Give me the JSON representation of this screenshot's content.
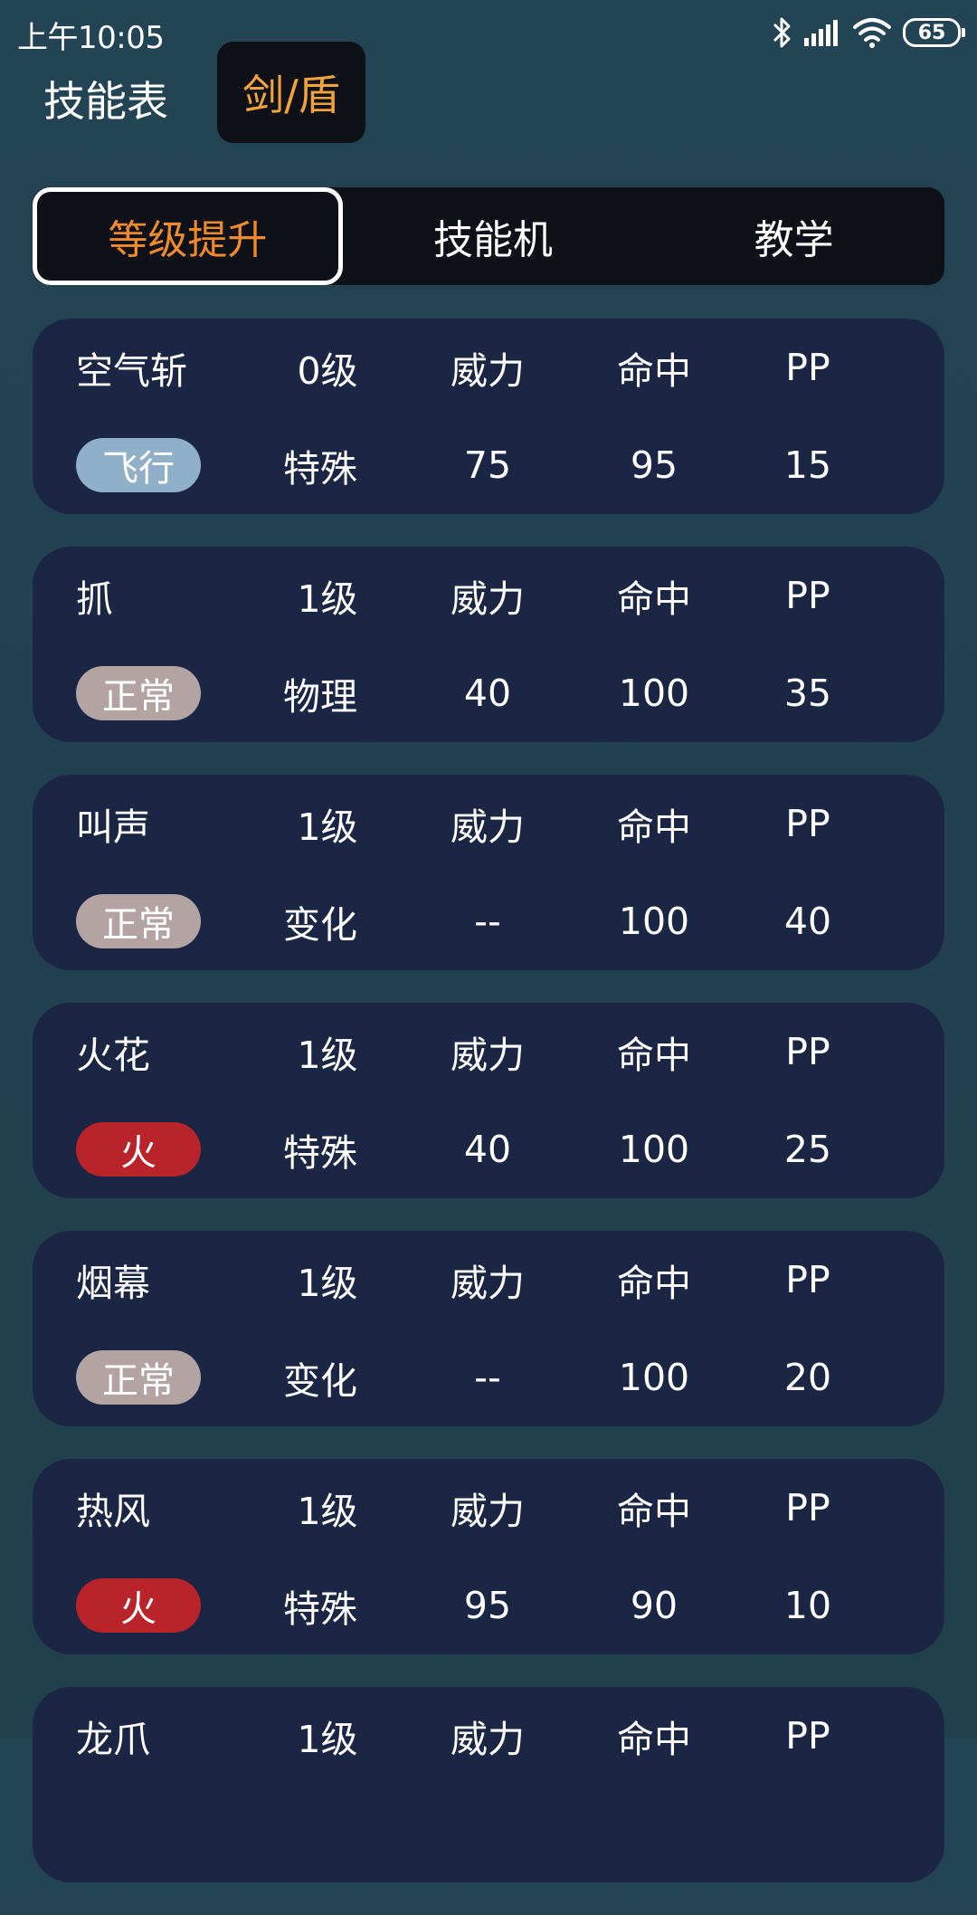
{
  "status_bar": {
    "time": "上午10:05",
    "battery": "65"
  },
  "header": {
    "title": "技能表",
    "version_label": "剑/盾"
  },
  "tabs": [
    {
      "label": "等级提升",
      "active": true
    },
    {
      "label": "技能机",
      "active": false
    },
    {
      "label": "教学",
      "active": false
    }
  ],
  "moves": [
    {
      "name": "空气斩",
      "level": "0级",
      "power_label": "威力",
      "accuracy_label": "命中",
      "pp_label": "PP",
      "type": "飞行",
      "type_color": "#8fb0c8",
      "category": "特殊",
      "power": "75",
      "accuracy": "95",
      "pp": "15"
    },
    {
      "name": "抓",
      "level": "1级",
      "power_label": "威力",
      "accuracy_label": "命中",
      "pp_label": "PP",
      "type": "正常",
      "type_color": "#b3a3a3",
      "category": "物理",
      "power": "40",
      "accuracy": "100",
      "pp": "35"
    },
    {
      "name": "叫声",
      "level": "1级",
      "power_label": "威力",
      "accuracy_label": "命中",
      "pp_label": "PP",
      "type": "正常",
      "type_color": "#b3a3a3",
      "category": "变化",
      "power": "--",
      "accuracy": "100",
      "pp": "40"
    },
    {
      "name": "火花",
      "level": "1级",
      "power_label": "威力",
      "accuracy_label": "命中",
      "pp_label": "PP",
      "type": "火",
      "type_color": "#b9232a",
      "category": "特殊",
      "power": "40",
      "accuracy": "100",
      "pp": "25"
    },
    {
      "name": "烟幕",
      "level": "1级",
      "power_label": "威力",
      "accuracy_label": "命中",
      "pp_label": "PP",
      "type": "正常",
      "type_color": "#b3a3a3",
      "category": "变化",
      "power": "--",
      "accuracy": "100",
      "pp": "20"
    },
    {
      "name": "热风",
      "level": "1级",
      "power_label": "威力",
      "accuracy_label": "命中",
      "pp_label": "PP",
      "type": "火",
      "type_color": "#b9232a",
      "category": "特殊",
      "power": "95",
      "accuracy": "90",
      "pp": "10"
    },
    {
      "name": "龙爪",
      "level": "1级",
      "power_label": "威力",
      "accuracy_label": "命中",
      "pp_label": "PP",
      "type": "",
      "type_color": "",
      "category": "",
      "power": "",
      "accuracy": "",
      "pp": ""
    }
  ]
}
